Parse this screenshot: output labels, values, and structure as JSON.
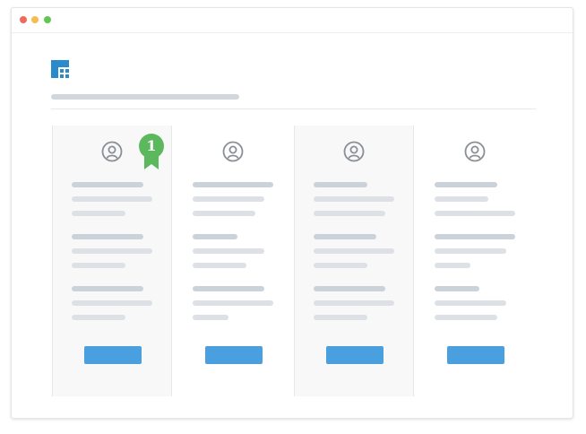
{
  "window": {
    "controls": [
      {
        "name": "close",
        "color": "#ee6a5e"
      },
      {
        "name": "minimize",
        "color": "#f5bd4f"
      },
      {
        "name": "maximize",
        "color": "#62c554"
      }
    ]
  },
  "logo": {
    "icon": "grid-logo-icon",
    "color": "#2a8acb"
  },
  "colors": {
    "accent": "#4a9fdf",
    "badge": "#5cb85c",
    "avatar": "#8a8f95"
  },
  "plans": [
    {
      "icon": "user-icon",
      "highlighted": true,
      "badge": "1"
    },
    {
      "icon": "user-icon",
      "highlighted": false
    },
    {
      "icon": "user-icon",
      "highlighted": true
    },
    {
      "icon": "user-icon",
      "highlighted": false
    }
  ]
}
